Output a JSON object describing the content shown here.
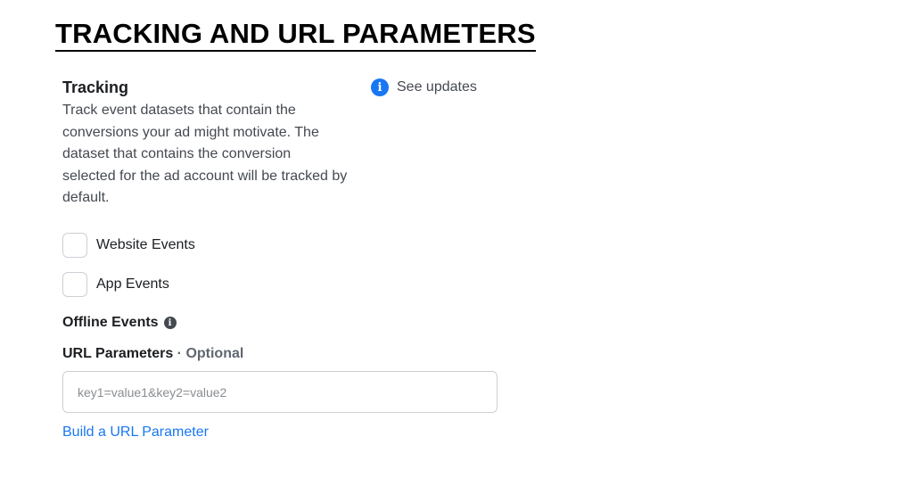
{
  "heading": "TRACKING AND URL PARAMETERS",
  "tracking": {
    "title": "Tracking",
    "description": "Track event datasets that contain the conversions your ad might motivate. The dataset that contains the conversion selected for the ad account will be tracked by default.",
    "see_updates_label": "See updates",
    "see_updates_icon": "info-icon"
  },
  "events": {
    "website_label": "Website Events",
    "website_checked": false,
    "app_label": "App Events",
    "app_checked": false,
    "offline_label": "Offline Events",
    "offline_icon": "info-icon"
  },
  "url_parameters": {
    "label": "URL Parameters",
    "separator": " · ",
    "optional_label": "Optional",
    "value": "",
    "placeholder": "key1=value1&key2=value2",
    "build_link_label": "Build a URL Parameter"
  },
  "colors": {
    "accent": "#1877f2",
    "text": "#1c1e21",
    "muted": "#444950",
    "border": "#ccd0d5"
  }
}
